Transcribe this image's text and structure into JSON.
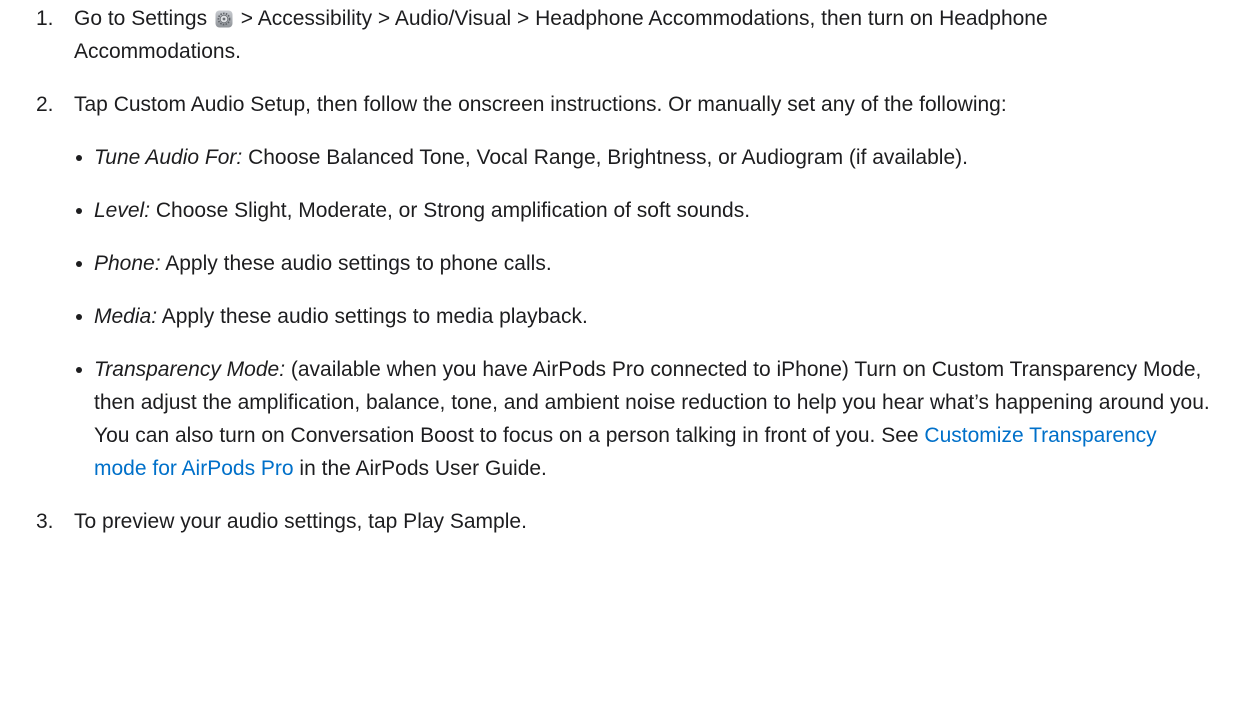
{
  "steps": [
    {
      "number": "1.",
      "part1": "Go to Settings",
      "icon": "settings-gear-icon",
      "part2": " > Accessibility > Audio/Visual > Headphone Accommodations, then turn on Headphone Accommodations."
    },
    {
      "number": "2.",
      "text": "Tap Custom Audio Setup, then follow the onscreen instructions. Or manually set any of the following:",
      "options": [
        {
          "term": "Tune Audio For:",
          "text": " Choose Balanced Tone, Vocal Range, Brightness, or Audiogram (if available)."
        },
        {
          "term": "Level:",
          "text": " Choose Slight, Moderate, or Strong amplification of soft sounds."
        },
        {
          "term": "Phone:",
          "text": " Apply these audio settings to phone calls."
        },
        {
          "term": "Media:",
          "text": " Apply these audio settings to media playback."
        },
        {
          "term": "Transparency Mode:",
          "text": " (available when you have AirPods Pro connected to iPhone) Turn on Custom Transparency Mode, then adjust the amplification, balance, tone, and ambient noise reduction to help you hear what’s happening around you. You can also turn on Conversation Boost to focus on a person talking in front of you. See ",
          "link_text": "Customize Transparency mode for AirPods Pro",
          "after_link": " in the AirPods User Guide."
        }
      ]
    },
    {
      "number": "3.",
      "text": "To preview your audio settings, tap Play Sample."
    }
  ],
  "colors": {
    "text": "#1d1d1f",
    "link": "#0070c9"
  }
}
